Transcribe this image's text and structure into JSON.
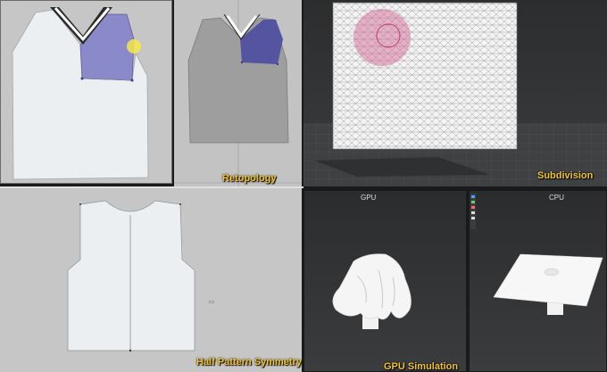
{
  "panels": {
    "pattern_edit": {
      "caption": ""
    },
    "retopology": {
      "caption": "Retopology"
    },
    "subdivision": {
      "caption": "Subdivision"
    },
    "half_pattern": {
      "caption": "Half Pattern Symmetry",
      "cursor_mark": "⊂⊃"
    },
    "gpu_viewport": {
      "label": "GPU",
      "caption": "GPU Simulation"
    },
    "cpu_viewport": {
      "label": "CPU"
    }
  },
  "colors": {
    "viewport_gray": "#c6c6c6",
    "dark_viewport": "#2f3133",
    "pattern_white": "#eceff1",
    "selection_purple": "#8a89c9",
    "caption_yellow": "#f2c230",
    "brush_pink": "#d0608e",
    "cursor_yellow": "#f3e84a"
  },
  "icons": [
    "cursor-icon",
    "brush-icon",
    "toolbar-icon"
  ]
}
